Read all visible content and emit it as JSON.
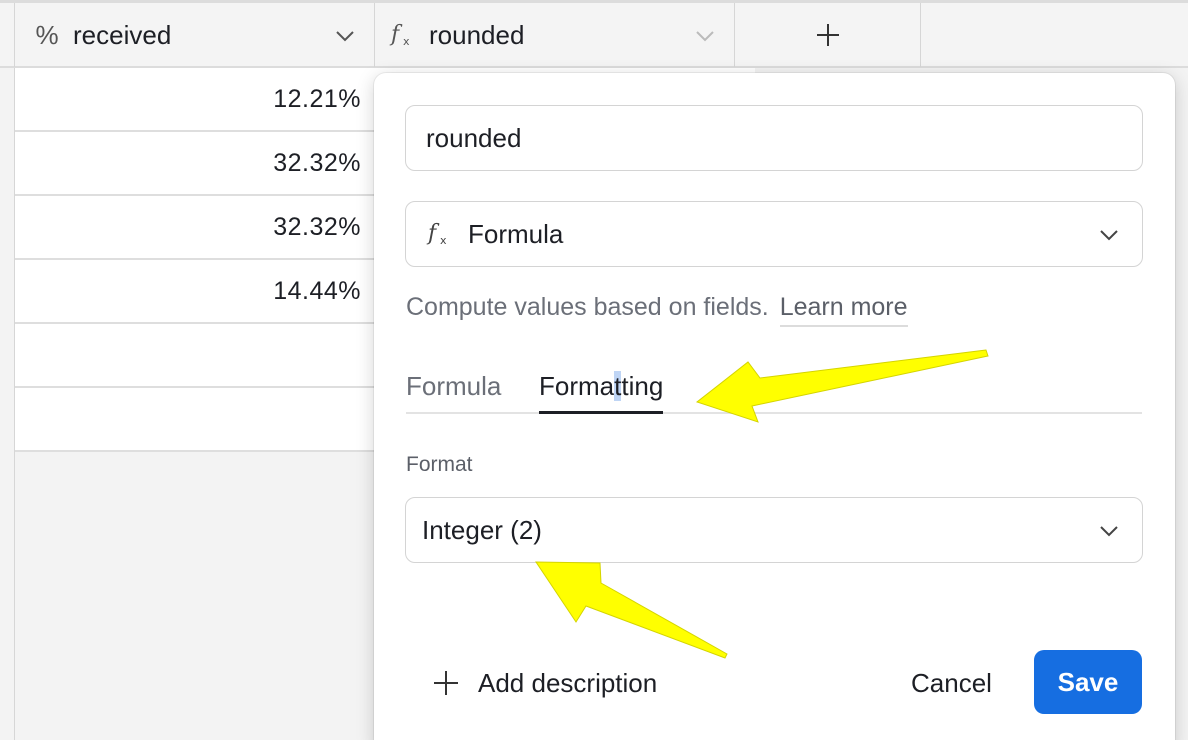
{
  "header": {
    "columns": [
      {
        "icon": "percent-icon",
        "label": "received"
      },
      {
        "icon": "formula-icon",
        "label": "rounded"
      }
    ],
    "add_column_icon": "plus-icon"
  },
  "rows": [
    {
      "received": "12.21%"
    },
    {
      "received": "32.32%"
    },
    {
      "received": "32.32%"
    },
    {
      "received": "14.44%"
    },
    {
      "received": ""
    },
    {
      "received": ""
    }
  ],
  "popover": {
    "field_name_value": "rounded",
    "field_type": "Formula",
    "description": "Compute values based on fields.",
    "learn_more": "Learn more",
    "tabs": [
      {
        "label": "Formula",
        "active": false
      },
      {
        "label_parts": [
          "Forma",
          "t",
          "ting"
        ],
        "active": true
      }
    ],
    "format_label": "Format",
    "format_value": "Integer (2)",
    "add_description": "Add description",
    "cancel": "Cancel",
    "save": "Save"
  },
  "colors": {
    "accent": "#166ee1",
    "annotation_arrow": "#ffff00",
    "active_tab_underline": "#1d1f25"
  },
  "glyphs": {
    "percent": "%",
    "formula": "f",
    "formula_sub": "x"
  }
}
